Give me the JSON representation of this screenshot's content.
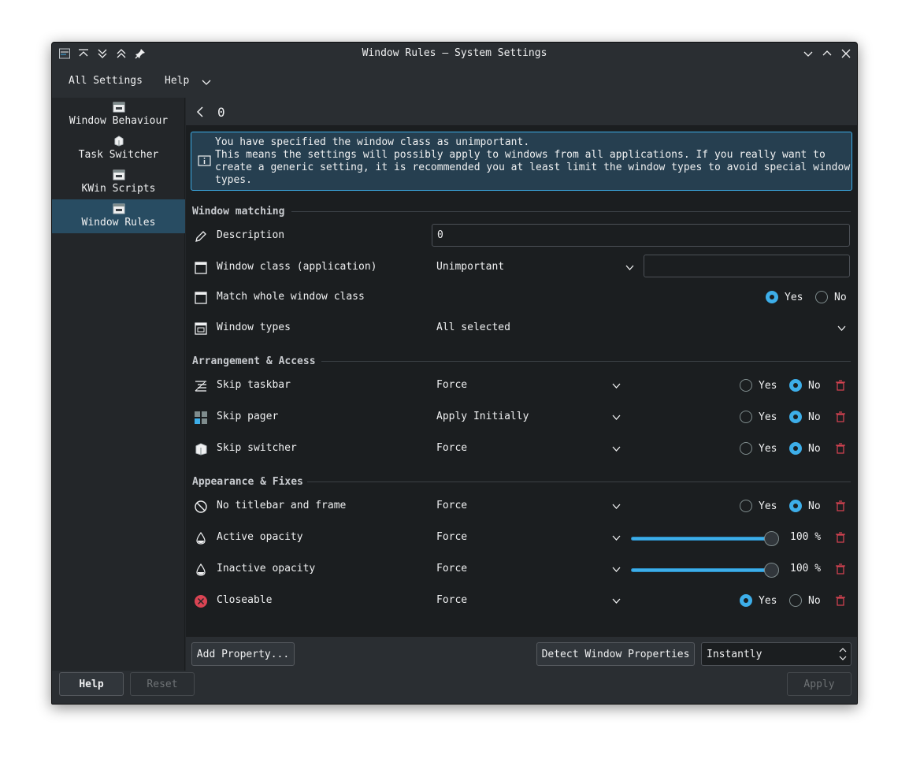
{
  "window": {
    "title": "Window Rules — System Settings"
  },
  "menubar": {
    "all_settings": "All Settings",
    "help": "Help"
  },
  "sidebar": {
    "items": [
      {
        "label": "Window Behaviour",
        "icon": "window-icon"
      },
      {
        "label": "Task Switcher",
        "icon": "task-switcher-icon"
      },
      {
        "label": "KWin Scripts",
        "icon": "window-icon"
      },
      {
        "label": "Window Rules",
        "icon": "window-icon",
        "active": true
      }
    ]
  },
  "page": {
    "title": "0"
  },
  "info": {
    "text": "You have specified the window class as unimportant.\nThis means the settings will possibly apply to windows from all applications. If you really want to\ncreate a generic setting, it is recommended you at least limit the window types to avoid special window\ntypes."
  },
  "sections": {
    "matching": "Window matching",
    "arrangement": "Arrangement & Access",
    "appearance": "Appearance & Fixes"
  },
  "matching": {
    "description": {
      "label": "Description",
      "value": "0"
    },
    "window_class": {
      "label": "Window class (application)",
      "policy": "Unimportant",
      "value": ""
    },
    "whole_class": {
      "label": "Match whole window class",
      "yes": "Yes",
      "no": "No",
      "selected": "Yes"
    },
    "window_types": {
      "label": "Window types",
      "value": "All selected"
    }
  },
  "arrangement": [
    {
      "label": "Skip taskbar",
      "policy": "Force",
      "yes": "Yes",
      "no": "No",
      "selected": "No"
    },
    {
      "label": "Skip pager",
      "policy": "Apply Initially",
      "yes": "Yes",
      "no": "No",
      "selected": "No"
    },
    {
      "label": "Skip switcher",
      "policy": "Force",
      "yes": "Yes",
      "no": "No",
      "selected": "No"
    }
  ],
  "appearance": [
    {
      "label": "No titlebar and frame",
      "policy": "Force",
      "yes": "Yes",
      "no": "No",
      "selected": "No"
    },
    {
      "label": "Active opacity",
      "policy": "Force",
      "value": "100 %",
      "level": 1.0
    },
    {
      "label": "Inactive opacity",
      "policy": "Force",
      "value": "100 %",
      "level": 1.0
    },
    {
      "label": "Closeable",
      "policy": "Force",
      "yes": "Yes",
      "no": "No",
      "selected": "Yes"
    }
  ],
  "bottombar": {
    "add_property": "Add Property...",
    "detect": "Detect Window Properties",
    "detect_delay": "Instantly"
  },
  "footer": {
    "help": "Help",
    "reset": "Reset",
    "apply": "Apply"
  },
  "colors": {
    "accent": "#3daee9",
    "selection": "#284c62",
    "danger": "#da4453"
  }
}
